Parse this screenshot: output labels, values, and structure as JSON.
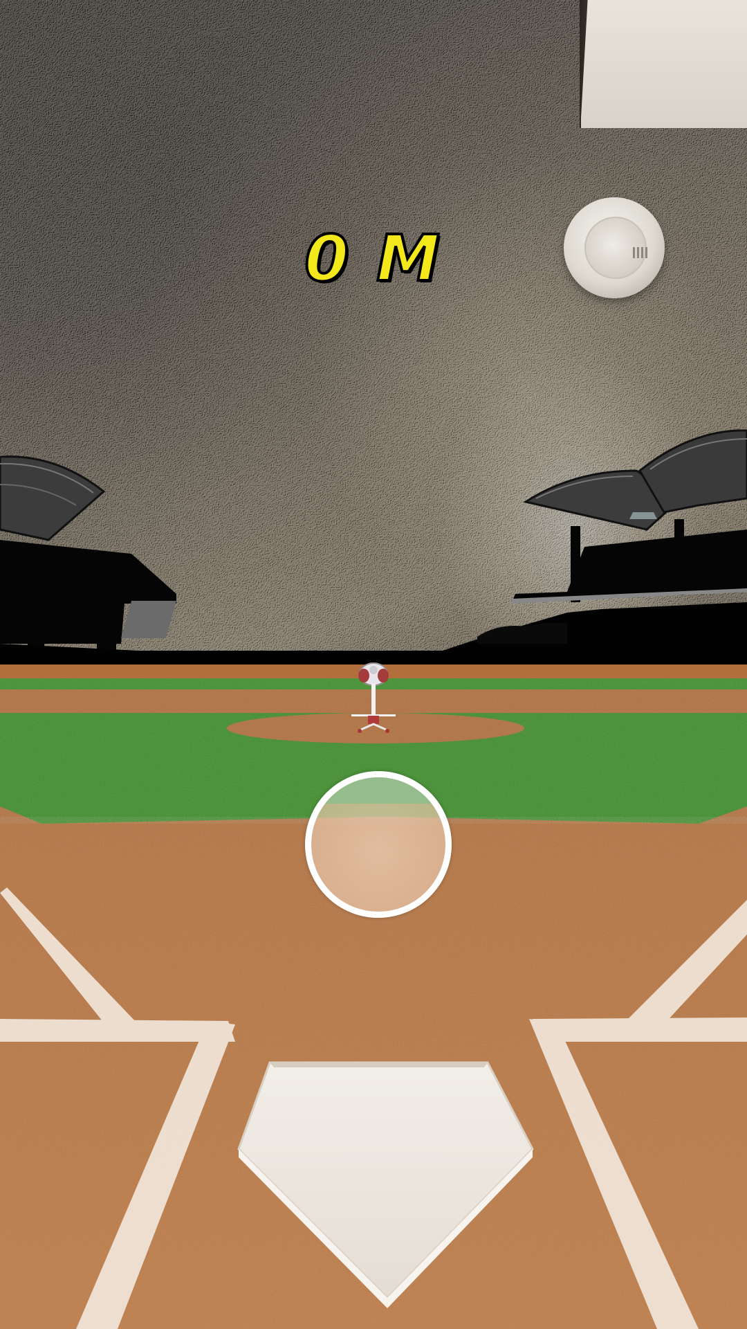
{
  "hud": {
    "distance_label": "0 M"
  },
  "colors": {
    "score_text": "#f3e81c",
    "score_outline": "#000000",
    "grass": "#3f8f2c",
    "dirt": "#b8743f",
    "chalk": "#efe3d6"
  },
  "icons": {
    "aim_target": "circle-outline-icon",
    "pitching_machine": "pitching-machine-icon"
  }
}
